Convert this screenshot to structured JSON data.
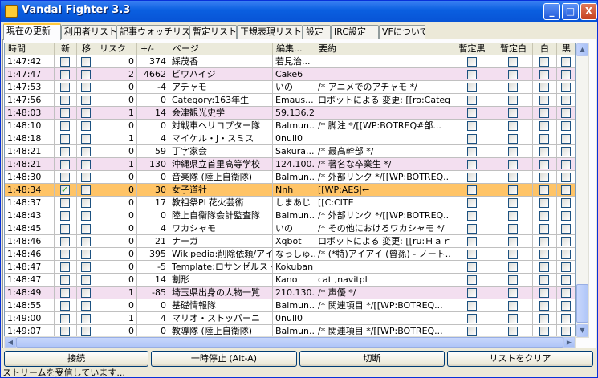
{
  "window": {
    "title": "Vandal Fighter 3.3",
    "accent": "#0a5fe0"
  },
  "title_buttons": {
    "minimize": "_",
    "maximize": "□",
    "close": "X"
  },
  "tabs": [
    "現在の更新",
    "利用者リスト",
    "記事ウォッチリスト",
    "暫定リスト",
    "正規表現リスト",
    "設定",
    "IRC設定",
    "VFについて"
  ],
  "active_tab": 0,
  "columns": [
    "時間",
    "新",
    "移",
    "リスク",
    "+/-",
    "ページ",
    "編集...",
    "要約",
    "暫定黒",
    "暫定白",
    "白",
    "黒"
  ],
  "row_colors": {
    "normal": "#ffffff",
    "pink": "#f3dff0",
    "selected": "#ffc467"
  },
  "rows": [
    {
      "time": "1:47:42",
      "new": false,
      "move": false,
      "risk": "0",
      "diff": "374",
      "page": "綵茂香",
      "editor": "若見治...",
      "summary": "",
      "color": "normal"
    },
    {
      "time": "1:47:47",
      "new": false,
      "move": false,
      "risk": "2",
      "diff": "4662",
      "page": "ビワハイジ",
      "editor": "Cake6",
      "summary": "",
      "color": "pink"
    },
    {
      "time": "1:47:53",
      "new": false,
      "move": false,
      "risk": "0",
      "diff": "-4",
      "page": "アチャモ",
      "editor": "いの",
      "summary": "/* アニメでのアチャモ */",
      "color": "normal"
    },
    {
      "time": "1:47:56",
      "new": false,
      "move": false,
      "risk": "0",
      "diff": "0",
      "page": "Category:163年生",
      "editor": "Emaus...",
      "summary": "ロボットによる 変更: [[ro:Categor...",
      "color": "normal"
    },
    {
      "time": "1:48:03",
      "new": false,
      "move": false,
      "risk": "1",
      "diff": "14",
      "page": "会津観光史学",
      "editor": "59.136.2...",
      "summary": "",
      "color": "pink"
    },
    {
      "time": "1:48:10",
      "new": false,
      "move": false,
      "risk": "0",
      "diff": "0",
      "page": "対戦車ヘリコプター隊",
      "editor": "Balmun...",
      "summary": "/* 脚注 */[[WP:BOTREQ#部...",
      "color": "normal"
    },
    {
      "time": "1:48:18",
      "new": false,
      "move": false,
      "risk": "1",
      "diff": "4",
      "page": "マイケル・J・スミス",
      "editor": "0null0",
      "summary": "",
      "color": "normal"
    },
    {
      "time": "1:48:21",
      "new": false,
      "move": false,
      "risk": "0",
      "diff": "59",
      "page": "丁字家会",
      "editor": "Sakura...",
      "summary": "/* 最高幹部 */",
      "color": "normal"
    },
    {
      "time": "1:48:21",
      "new": false,
      "move": false,
      "risk": "1",
      "diff": "130",
      "page": "沖縄県立首里高等学校",
      "editor": "124.100...",
      "summary": "/* 著名な卒業生 */",
      "color": "pink"
    },
    {
      "time": "1:48:30",
      "new": false,
      "move": false,
      "risk": "0",
      "diff": "0",
      "page": "音楽隊 (陸上自衛隊)",
      "editor": "Balmun...",
      "summary": "/* 外部リンク */[[WP:BOTREQ...",
      "color": "normal"
    },
    {
      "time": "1:48:34",
      "new": true,
      "move": false,
      "risk": "0",
      "diff": "30",
      "page": "女子道社",
      "editor": "Nnh",
      "summary": "[[WP:AES|←",
      "color": "selected"
    },
    {
      "time": "1:48:37",
      "new": false,
      "move": false,
      "risk": "0",
      "diff": "17",
      "page": "教祖祭PL花火芸術",
      "editor": "しまあじ",
      "summary": "[[C:CITE",
      "color": "normal"
    },
    {
      "time": "1:48:43",
      "new": false,
      "move": false,
      "risk": "0",
      "diff": "0",
      "page": "陸上自衛隊会計監査隊",
      "editor": "Balmun...",
      "summary": "/* 外部リンク */[[WP:BOTREQ...",
      "color": "normal"
    },
    {
      "time": "1:48:45",
      "new": false,
      "move": false,
      "risk": "0",
      "diff": "4",
      "page": "ワカシャモ",
      "editor": "いの",
      "summary": "/* その他におけるワカシャモ */",
      "color": "normal"
    },
    {
      "time": "1:48:46",
      "new": false,
      "move": false,
      "risk": "0",
      "diff": "21",
      "page": "ナーガ",
      "editor": "Xqbot",
      "summary": "ロボットによる 変更: [[ru:Ｈａｒ...",
      "color": "normal"
    },
    {
      "time": "1:48:46",
      "new": false,
      "move": false,
      "risk": "0",
      "diff": "395",
      "page": "Wikipedia:削除依頼/アイ...",
      "editor": "なっしゅ...",
      "summary": "/* (*特)アイアイ (曾孫) - ノート...",
      "color": "normal"
    },
    {
      "time": "1:48:47",
      "new": false,
      "move": false,
      "risk": "0",
      "diff": "-5",
      "page": "Template:ロサンゼルス・ク...",
      "editor": "Kokuban",
      "summary": "",
      "color": "normal"
    },
    {
      "time": "1:48:47",
      "new": false,
      "move": false,
      "risk": "0",
      "diff": "14",
      "page": "割形",
      "editor": "Kano",
      "summary": "cat ,navitpl",
      "color": "normal"
    },
    {
      "time": "1:48:49",
      "new": false,
      "move": false,
      "risk": "1",
      "diff": "-85",
      "page": "埼玉県出身の人物一覧",
      "editor": "210.130...",
      "summary": "/* 声優 */",
      "color": "pink"
    },
    {
      "time": "1:48:55",
      "new": false,
      "move": false,
      "risk": "0",
      "diff": "0",
      "page": "基礎情報隊",
      "editor": "Balmun...",
      "summary": "/* 関連項目 */[[WP:BOTREQ...",
      "color": "normal"
    },
    {
      "time": "1:49:00",
      "new": false,
      "move": false,
      "risk": "1",
      "diff": "4",
      "page": "マリオ・ストッパーニ",
      "editor": "0null0",
      "summary": "",
      "color": "normal"
    },
    {
      "time": "1:49:07",
      "new": false,
      "move": false,
      "risk": "0",
      "diff": "0",
      "page": "教導隊 (陸上自衛隊)",
      "editor": "Balmun...",
      "summary": "/* 関連項目 */[[WP:BOTREQ...",
      "color": "normal"
    }
  ],
  "buttons": {
    "connect": "接続",
    "pause": "一時停止 (Alt-A)",
    "disconnect": "切断",
    "clear": "リストをクリア"
  },
  "status": "ストリームを受信しています..."
}
